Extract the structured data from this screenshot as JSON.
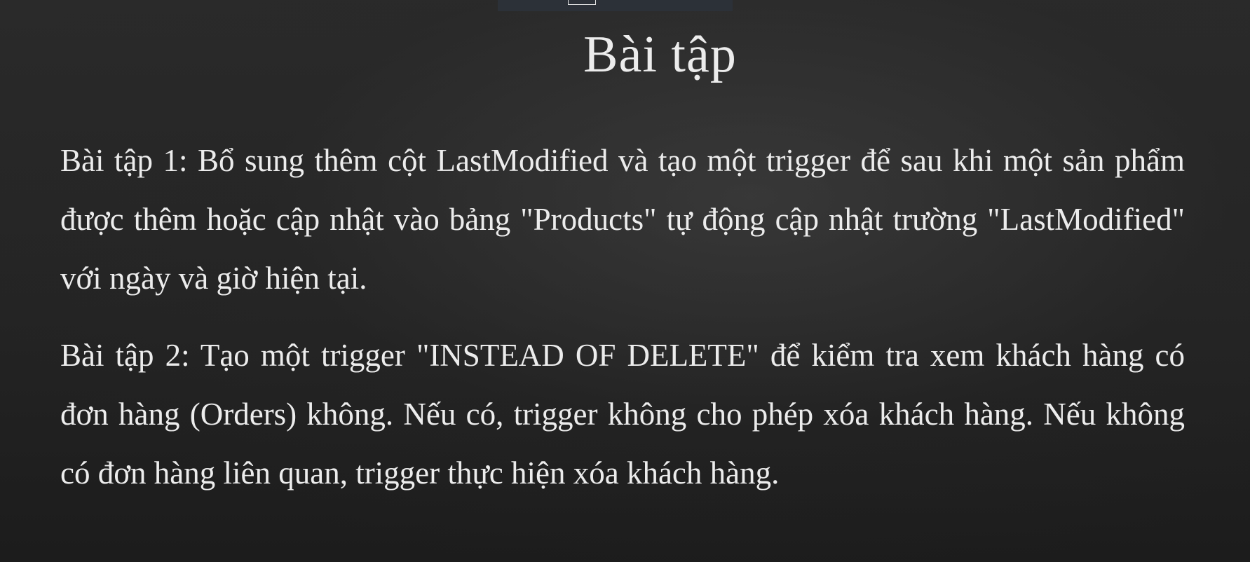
{
  "slide": {
    "title": "Bài tập",
    "exercises": [
      {
        "text": "Bài tập 1: Bổ sung thêm cột LastModified và tạo một trigger để sau khi một sản phẩm được thêm hoặc cập nhật vào bảng \"Products\" tự động cập nhật trường \"LastModified\" với ngày và giờ hiện tại."
      },
      {
        "text": "Bài tập 2: Tạo một trigger \"INSTEAD OF DELETE\" để kiểm tra xem khách hàng có đơn hàng (Orders) không. Nếu có, trigger không cho phép xóa khách hàng. Nếu không có đơn hàng liên quan, trigger thực hiện xóa khách hàng."
      }
    ]
  },
  "colors": {
    "background": "#242424",
    "text": "#ececec"
  }
}
